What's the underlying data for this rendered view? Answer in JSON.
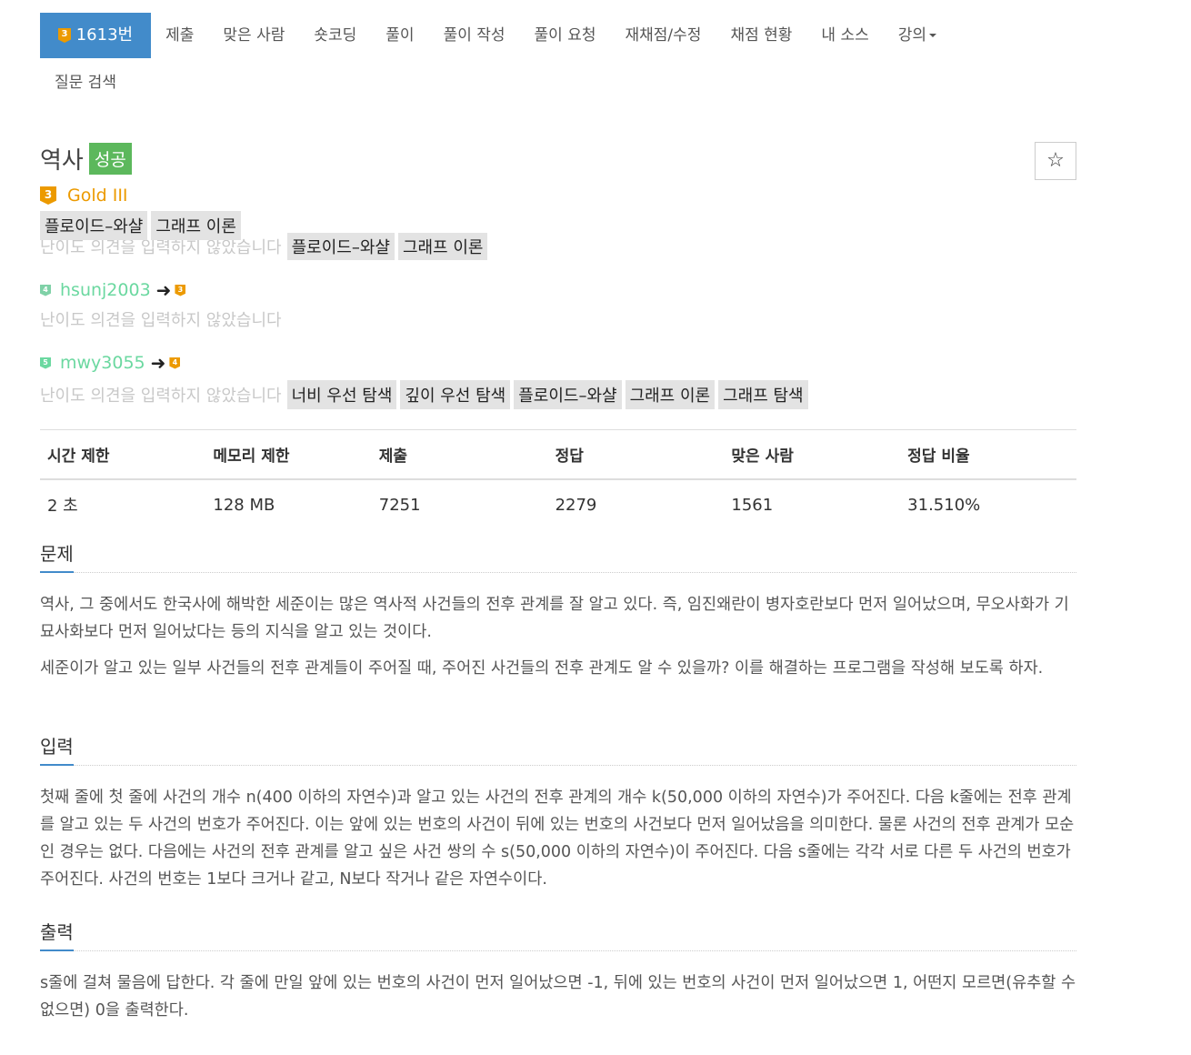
{
  "nav": {
    "active_tier": "3",
    "active_label": "1613번",
    "items": [
      "제출",
      "맞은 사람",
      "숏코딩",
      "풀이",
      "풀이 작성",
      "풀이 요청",
      "재채점/수정",
      "채점 현황",
      "내 소스"
    ],
    "dropdown_label": "강의",
    "row2_items": [
      "질문 검색"
    ]
  },
  "problem": {
    "title": "역사",
    "result_badge": "성공",
    "star_icon": "☆",
    "tier_icon_text": "3",
    "tier_label": "Gold III",
    "tags": [
      "플로이드–와샬",
      "그래프 이론"
    ]
  },
  "opinions": [
    {
      "user": "",
      "tags": [
        "플로이드–와샬",
        "그래프 이론"
      ],
      "text": "난이도 의견을 입력하지 않았습니다"
    },
    {
      "user": "hsunj2003",
      "user_tier": "4",
      "to_tier": "3",
      "text": "난이도 의견을 입력하지 않았습니다",
      "tags": []
    },
    {
      "user": "mwy3055",
      "user_tier": "5",
      "to_tier": "4",
      "text": "난이도 의견을 입력하지 않았습니다",
      "tags": [
        "너비 우선 탐색",
        "깊이 우선 탐색",
        "플로이드–와샬",
        "그래프 이론",
        "그래프 탐색"
      ]
    }
  ],
  "arrow_glyph": "➜",
  "stats": {
    "headers": [
      "시간 제한",
      "메모리 제한",
      "제출",
      "정답",
      "맞은 사람",
      "정답 비율"
    ],
    "values": [
      "2 초",
      "128 MB",
      "7251",
      "2279",
      "1561",
      "31.510%"
    ]
  },
  "sections": {
    "problem": {
      "heading": "문제",
      "paragraphs": [
        "역사, 그 중에서도 한국사에 해박한 세준이는 많은 역사적 사건들의 전후 관계를 잘 알고 있다. 즉, 임진왜란이 병자호란보다 먼저 일어났으며, 무오사화가 기묘사화보다 먼저 일어났다는 등의 지식을 알고 있는 것이다.",
        "세준이가 알고 있는 일부 사건들의 전후 관계들이 주어질 때, 주어진 사건들의 전후 관계도 알 수 있을까? 이를 해결하는 프로그램을 작성해 보도록 하자."
      ]
    },
    "input": {
      "heading": "입력",
      "paragraphs": [
        "첫째 줄에 첫 줄에 사건의 개수 n(400 이하의 자연수)과 알고 있는 사건의 전후 관계의 개수 k(50,000 이하의 자연수)가 주어진다. 다음 k줄에는 전후 관계를 알고 있는 두 사건의 번호가 주어진다. 이는 앞에 있는 번호의 사건이 뒤에 있는 번호의 사건보다 먼저 일어났음을 의미한다. 물론 사건의 전후 관계가 모순인 경우는 없다. 다음에는 사건의 전후 관계를 알고 싶은 사건 쌍의 수 s(50,000 이하의 자연수)이 주어진다. 다음 s줄에는 각각 서로 다른 두 사건의 번호가 주어진다. 사건의 번호는 1보다 크거나 같고, N보다 작거나 같은 자연수이다."
      ]
    },
    "output": {
      "heading": "출력",
      "paragraphs": [
        "s줄에 걸쳐 물음에 답한다. 각 줄에 만일 앞에 있는 번호의 사건이 먼저 일어났으면 -1, 뒤에 있는 번호의 사건이 먼저 일어났으면 1, 어떤지 모르면(유추할 수 없으면) 0을 출력한다."
      ]
    }
  }
}
